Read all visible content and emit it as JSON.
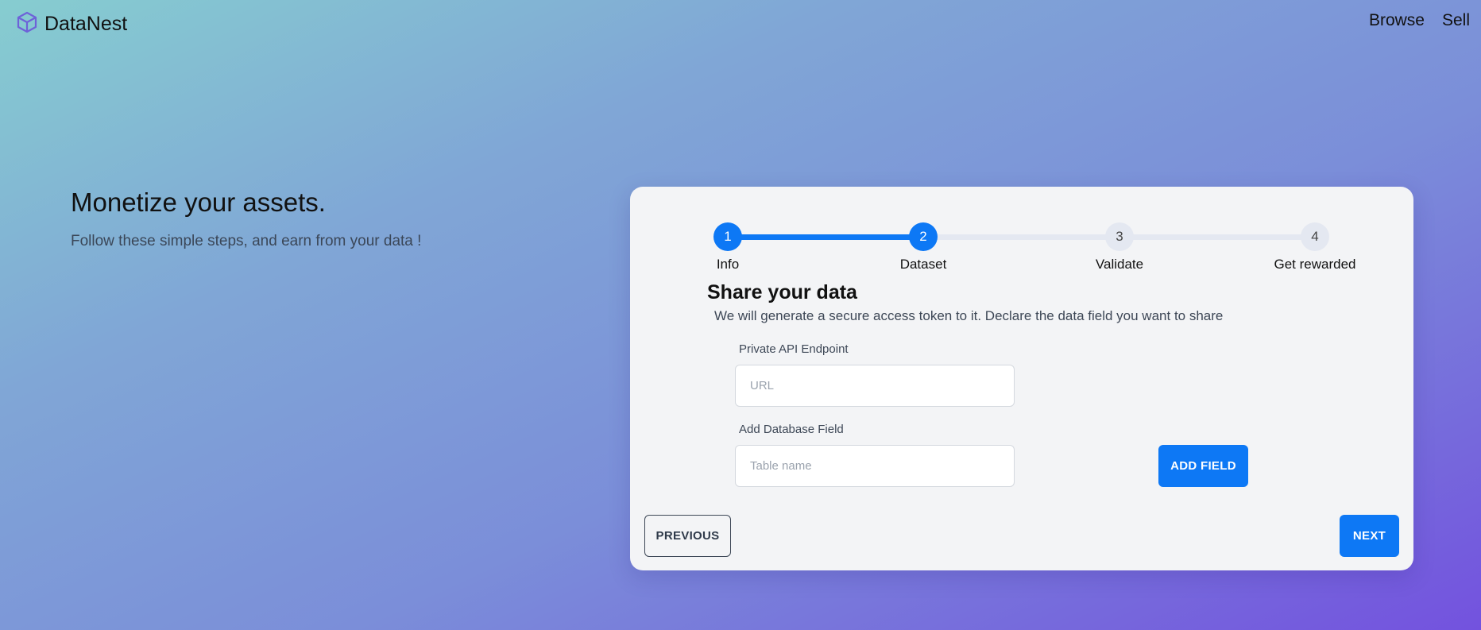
{
  "nav": {
    "brand": "DataNest",
    "brand_icon": "cube-icon",
    "links": [
      "Browse",
      "Sell"
    ]
  },
  "hero": {
    "title": "Monetize your assets.",
    "subtitle": "Follow these simple steps, and earn from your data !"
  },
  "stepper": {
    "current_step": 2,
    "steps": [
      {
        "number": "1",
        "label": "Info",
        "status": "complete"
      },
      {
        "number": "2",
        "label": "Dataset",
        "status": "current"
      },
      {
        "number": "3",
        "label": "Validate",
        "status": "pending"
      },
      {
        "number": "4",
        "label": "Get rewarded",
        "status": "pending"
      }
    ]
  },
  "form": {
    "title": "Share your data",
    "description": "We will generate a secure access token to it. Declare the data field you want to share",
    "endpoint": {
      "label": "Private API Endpoint",
      "placeholder": "URL",
      "value": ""
    },
    "db_field": {
      "label": "Add Database Field",
      "placeholder": "Table name",
      "value": ""
    },
    "add_field_label": "ADD FIELD"
  },
  "actions": {
    "previous_label": "PREVIOUS",
    "next_label": "NEXT"
  },
  "colors": {
    "accent": "#0d78f5",
    "track": "#e4e8f1",
    "card_bg": "#f3f4f6"
  }
}
